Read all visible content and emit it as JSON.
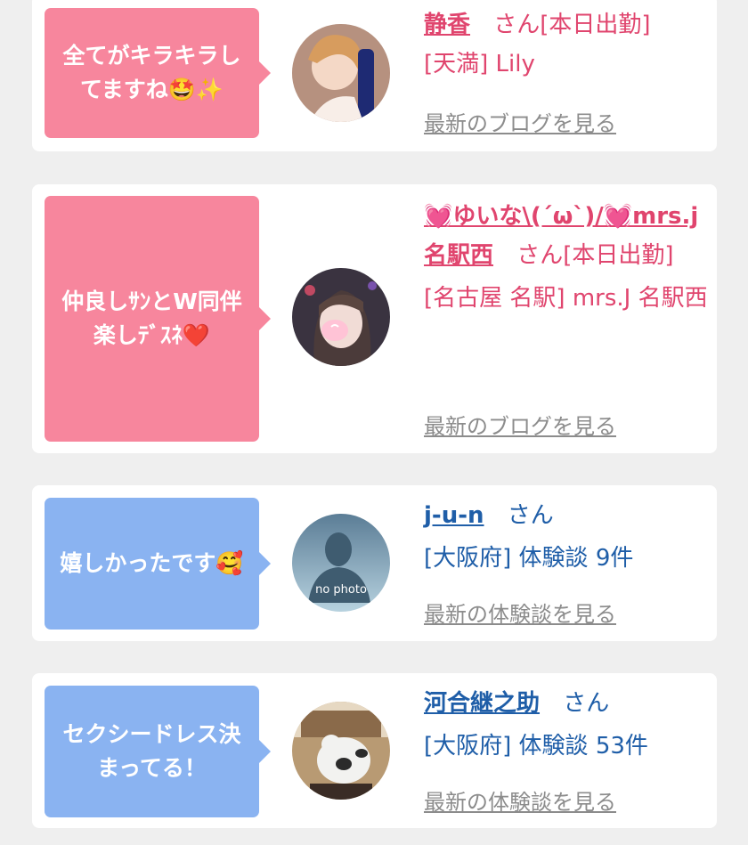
{
  "cards": [
    {
      "bubble": "全てがキラキラし\nてますね🤩✨",
      "name": "静香",
      "suffix": "さん[本日出勤]",
      "shop": "[天満] Lily",
      "link": "最新のブログを見る"
    },
    {
      "bubble": "仲良しｻﾝとW同伴\n楽しﾃﾞｽﾈ❤️",
      "name": "💓ゆいな\\(´ω`)/💓mrs.j名駅西",
      "suffix": "さん[本日出勤]",
      "shop": "[名古屋 名駅] mrs.J 名駅西",
      "link": "最新のブログを見る"
    },
    {
      "bubble": "嬉しかったです🥰",
      "name": "j-u-n",
      "suffix": "さん",
      "shop": "[大阪府] 体験談 9件",
      "link": "最新の体験談を見る",
      "avatar_text": "no photo"
    },
    {
      "bubble": "セクシードレス決\nまってる！",
      "name": "河合継之助",
      "suffix": "さん",
      "shop": "[大阪府] 体験談 53件",
      "link": "最新の体験談を見る"
    }
  ],
  "colors": {
    "pink_bubble": "#f7869d",
    "blue_bubble": "#8ab3f1",
    "pink_text": "#e0456e",
    "blue_text": "#1f5ea8"
  }
}
